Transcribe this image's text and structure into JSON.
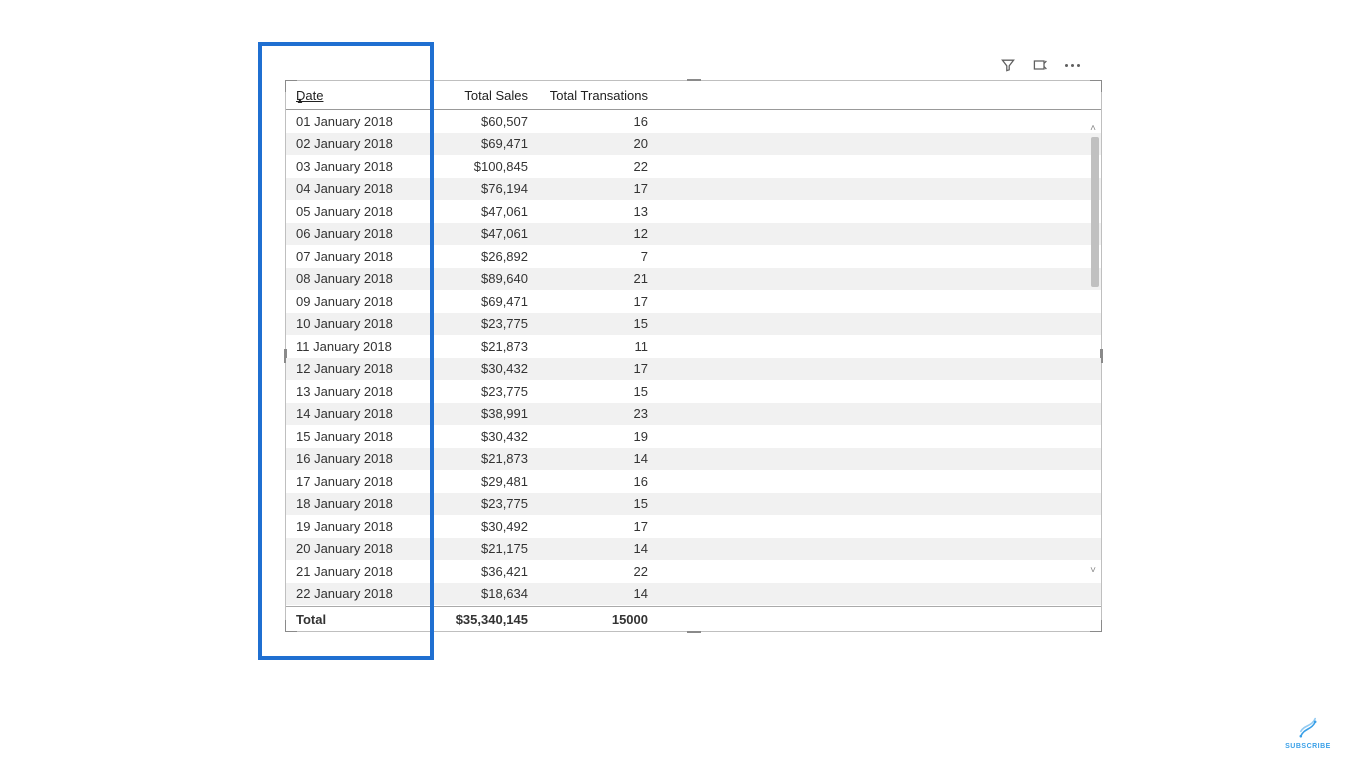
{
  "table": {
    "columns": {
      "date": {
        "label": "Date",
        "sorted": true
      },
      "sales": {
        "label": "Total Sales"
      },
      "trans": {
        "label": "Total Transations"
      }
    },
    "rows": [
      {
        "date": "01 January 2018",
        "sales": "$60,507",
        "trans": "16"
      },
      {
        "date": "02 January 2018",
        "sales": "$69,471",
        "trans": "20"
      },
      {
        "date": "03 January 2018",
        "sales": "$100,845",
        "trans": "22"
      },
      {
        "date": "04 January 2018",
        "sales": "$76,194",
        "trans": "17"
      },
      {
        "date": "05 January 2018",
        "sales": "$47,061",
        "trans": "13"
      },
      {
        "date": "06 January 2018",
        "sales": "$47,061",
        "trans": "12"
      },
      {
        "date": "07 January 2018",
        "sales": "$26,892",
        "trans": "7"
      },
      {
        "date": "08 January 2018",
        "sales": "$89,640",
        "trans": "21"
      },
      {
        "date": "09 January 2018",
        "sales": "$69,471",
        "trans": "17"
      },
      {
        "date": "10 January 2018",
        "sales": "$23,775",
        "trans": "15"
      },
      {
        "date": "11 January 2018",
        "sales": "$21,873",
        "trans": "11"
      },
      {
        "date": "12 January 2018",
        "sales": "$30,432",
        "trans": "17"
      },
      {
        "date": "13 January 2018",
        "sales": "$23,775",
        "trans": "15"
      },
      {
        "date": "14 January 2018",
        "sales": "$38,991",
        "trans": "23"
      },
      {
        "date": "15 January 2018",
        "sales": "$30,432",
        "trans": "19"
      },
      {
        "date": "16 January 2018",
        "sales": "$21,873",
        "trans": "14"
      },
      {
        "date": "17 January 2018",
        "sales": "$29,481",
        "trans": "16"
      },
      {
        "date": "18 January 2018",
        "sales": "$23,775",
        "trans": "15"
      },
      {
        "date": "19 January 2018",
        "sales": "$30,492",
        "trans": "17"
      },
      {
        "date": "20 January 2018",
        "sales": "$21,175",
        "trans": "14"
      },
      {
        "date": "21 January 2018",
        "sales": "$36,421",
        "trans": "22"
      },
      {
        "date": "22 January 2018",
        "sales": "$18,634",
        "trans": "14"
      }
    ],
    "total": {
      "label": "Total",
      "sales": "$35,340,145",
      "trans": "15000"
    }
  },
  "badge": {
    "label": "SUBSCRIBE"
  },
  "colors": {
    "highlight": "#1f6fd1"
  }
}
